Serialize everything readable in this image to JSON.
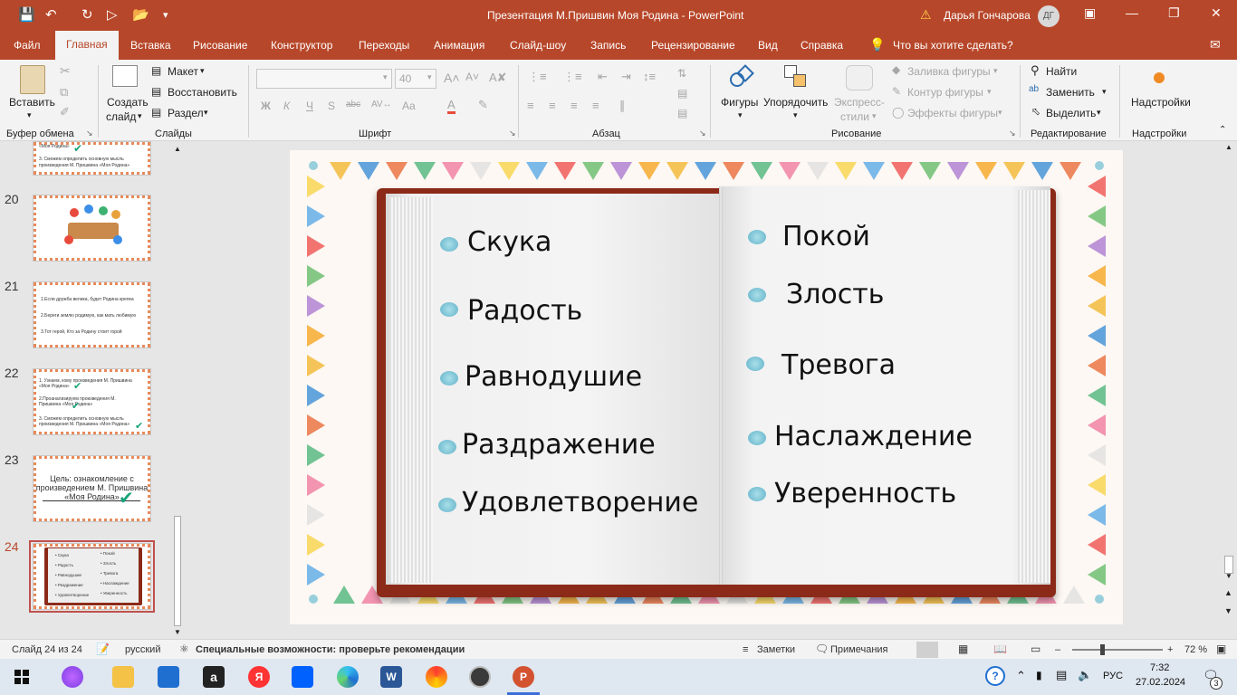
{
  "window": {
    "title": "Презентация М.Пришвин Моя Родина  -  PowerPoint",
    "user_name": "Дарья Гончарова",
    "user_initials": "ДГ"
  },
  "tabs": [
    "Файл",
    "Главная",
    "Вставка",
    "Рисование",
    "Конструктор",
    "Переходы",
    "Анимация",
    "Слайд-шоу",
    "Запись",
    "Рецензирование",
    "Вид",
    "Справка"
  ],
  "tell_me": "Что вы хотите сделать?",
  "ribbon": {
    "clipboard": {
      "paste": "Вставить",
      "group": "Буфер обмена"
    },
    "slides": {
      "new_slide_1": "Создать",
      "new_slide_2": "слайд",
      "layout": "Макет",
      "reset": "Восстановить",
      "section": "Раздел",
      "group": "Слайды"
    },
    "font": {
      "size": "40",
      "bold": "Ж",
      "italic": "К",
      "underline": "Ч",
      "shadow": "S",
      "strike": "abc",
      "case": "Aa",
      "group": "Шрифт"
    },
    "paragraph": {
      "group": "Абзац"
    },
    "drawing": {
      "shapes": "Фигуры",
      "arrange": "Упорядочить",
      "styles_1": "Экспресс-",
      "styles_2": "стили",
      "fill": "Заливка фигуры",
      "outline": "Контур фигуры",
      "effects": "Эффекты фигуры",
      "group": "Рисование"
    },
    "editing": {
      "find": "Найти",
      "replace": "Заменить",
      "select": "Выделить",
      "group": "Редактирование"
    },
    "addins": {
      "label": "Надстройки",
      "group": "Надстройки"
    }
  },
  "thumbnails": [
    {
      "num": "20"
    },
    {
      "num": "21",
      "lines": [
        "1.Если дружба велика, будет Родина крепка",
        "2.Береги землю родимую, как мать любимую",
        "3.Тот герой, Кто за Родину стоит горой"
      ]
    },
    {
      "num": "22",
      "lines": [
        "1. Узнаем, кому произведения М. Пришвина «Моя Родина»",
        "2.Проанализируем произведения М. Пришвина «Моя Родина»",
        "3. Сможем определить основную мысль произведения М. Пришвина «Моя Родина»"
      ]
    },
    {
      "num": "23",
      "lines": [
        "Цель: ознакомление с",
        "произведением М. Пришвина",
        "«Моя Родина»"
      ]
    },
    {
      "num": "24",
      "active": true
    }
  ],
  "top_partial_thumb": [
    "«Моя Родина»",
    "3. Сможем определить основную мысль",
    "произведения М. Пришвина «Моя Родина»"
  ],
  "slide": {
    "left_words": [
      "Скука",
      "Радость",
      "Равнодушие",
      "Раздражение",
      "Удовлетворение"
    ],
    "right_words": [
      "Покой",
      "Злость",
      "Тревога",
      "Наслаждение",
      "Уверенность"
    ]
  },
  "status": {
    "slide_pos": "Слайд 24 из 24",
    "language": "русский",
    "accessibility": "Специальные возможности: проверьте рекомендации",
    "notes": "Заметки",
    "comments": "Примечания",
    "zoom": "72 %"
  },
  "taskbar": {
    "lang": "РУС",
    "time": "7:32",
    "date": "27.02.2024",
    "notif_count": "3"
  },
  "colors": {
    "accent": "#b7472a",
    "bullet": "#7fc4d6",
    "book_cover": "#8b2a18"
  }
}
